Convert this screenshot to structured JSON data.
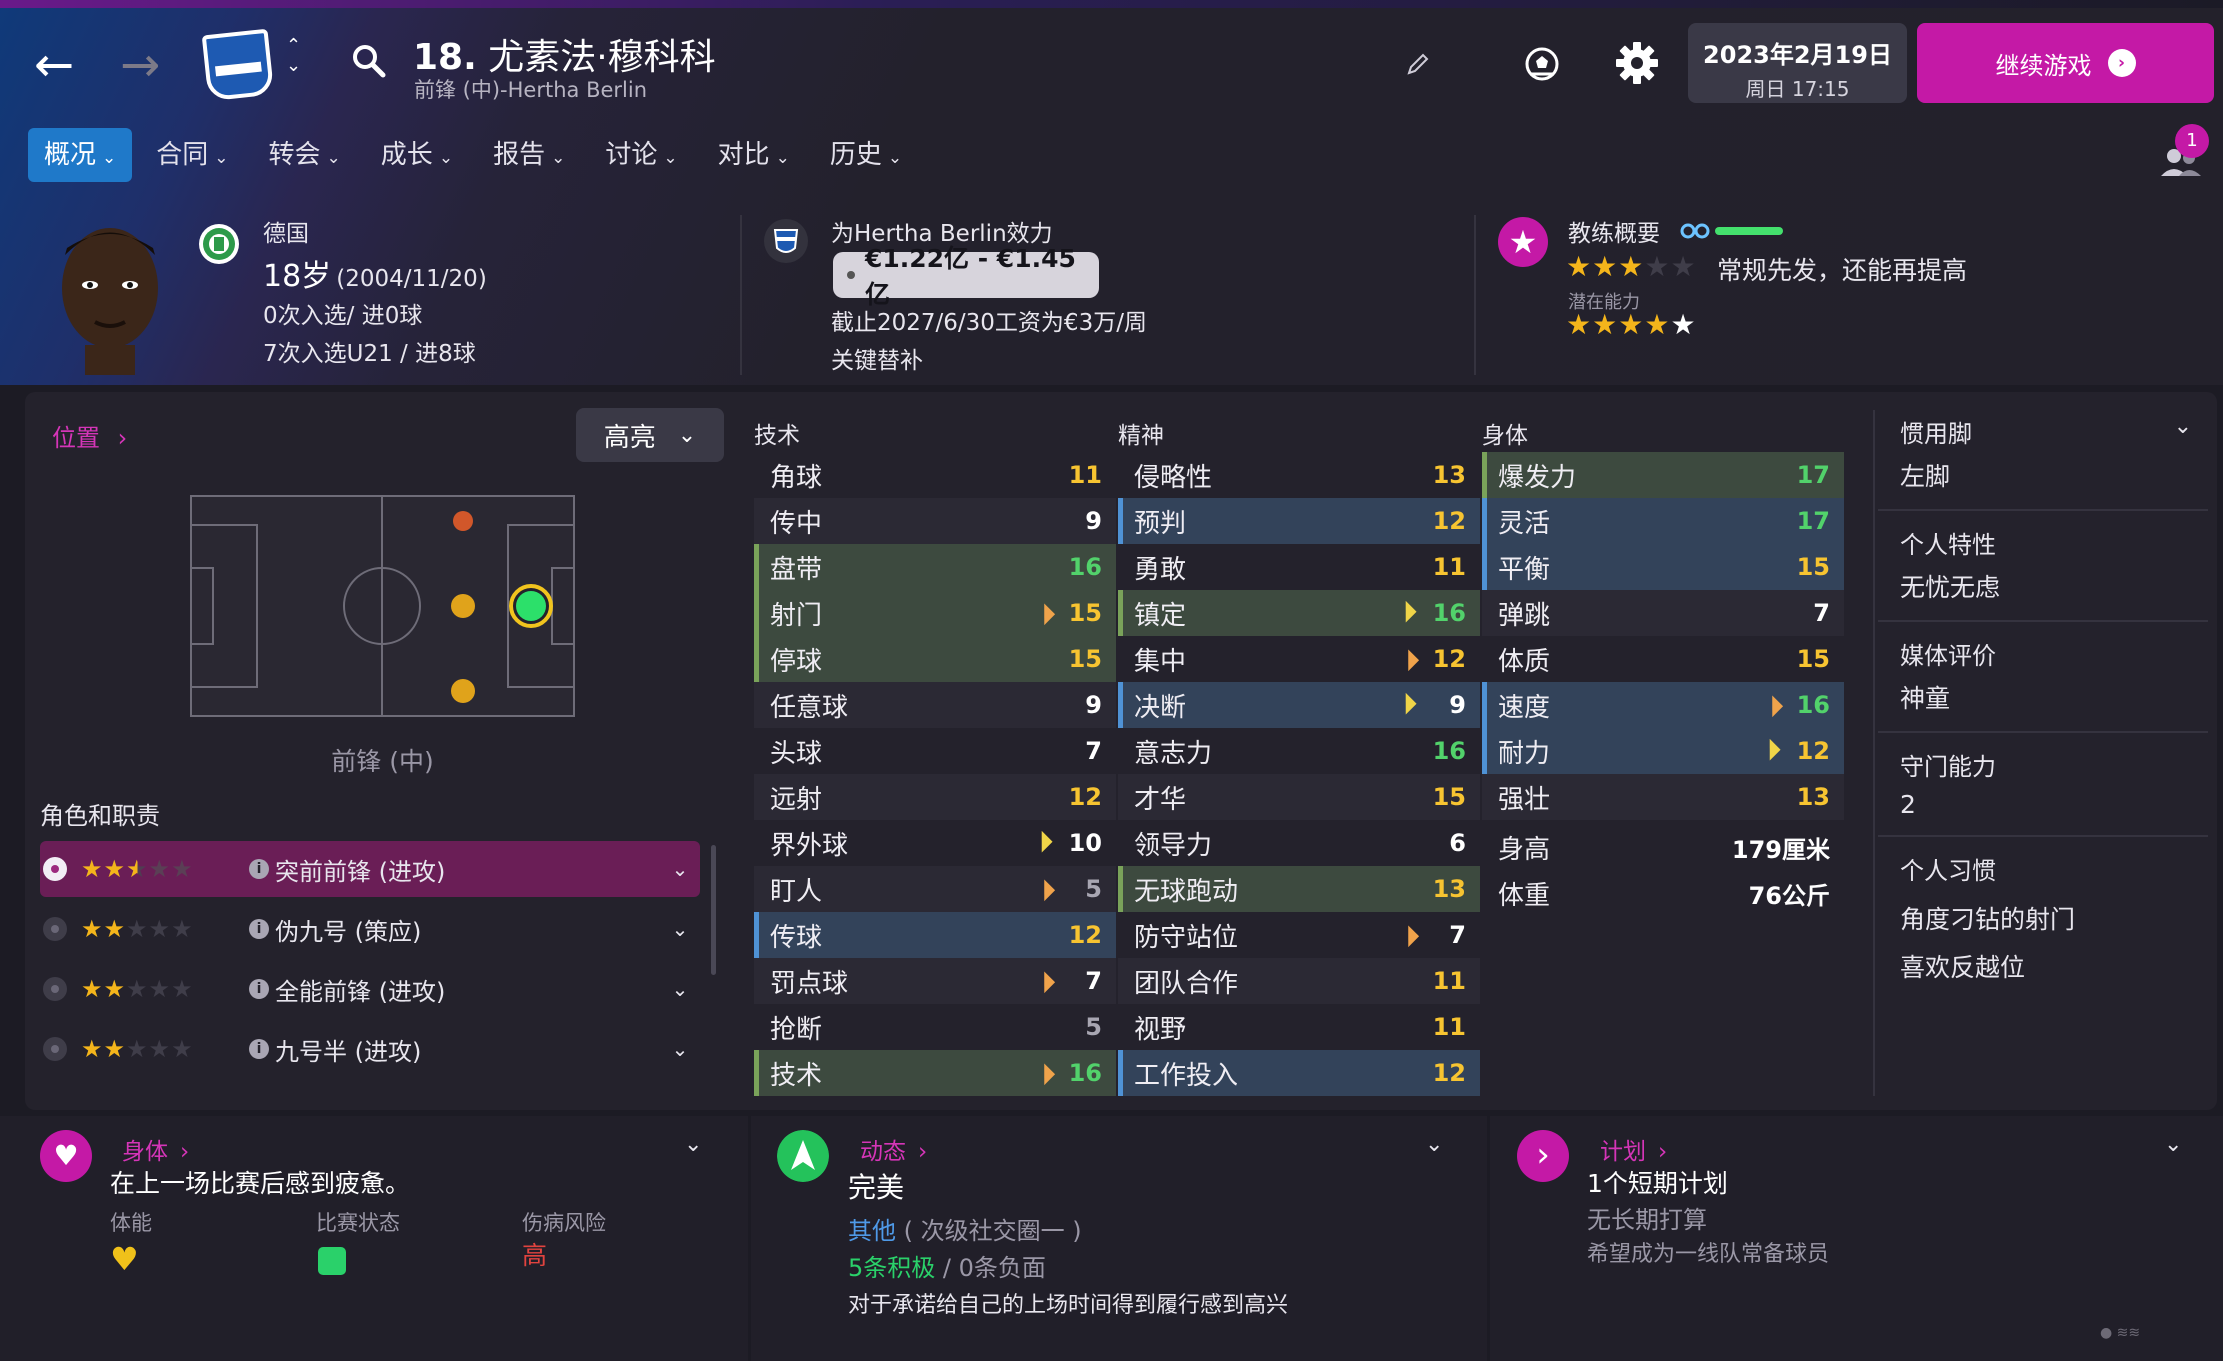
{
  "header": {
    "number": "18.",
    "name": "尤素法·穆科科",
    "subtitle": "前锋 (中)-Hertha Berlin",
    "date": "2023年2月19日",
    "weekday_time": "周日 17:15",
    "continue_label": "继续游戏",
    "notification_count": "1"
  },
  "tabs": [
    {
      "label": "概况"
    },
    {
      "label": "合同"
    },
    {
      "label": "转会"
    },
    {
      "label": "成长"
    },
    {
      "label": "报告"
    },
    {
      "label": "讨论"
    },
    {
      "label": "对比"
    },
    {
      "label": "历史"
    }
  ],
  "profile": {
    "nation": "德国",
    "age_prefix": "18岁",
    "birth": "(2004/11/20)",
    "caps": "0次入选/ 进0球",
    "u21_caps": "7次入选U21 / 进8球",
    "club_line": "为Hertha Berlin效力",
    "value": "€1.22亿 - €1.45亿",
    "contract": "截止2027/6/30工资为€3万/周",
    "squad_status": "关键替补",
    "coach_title": "教练概要",
    "coach_desc": "常规先发，还能再提高",
    "potential_label": "潜在能力",
    "current_stars": 3,
    "potential_stars": 5
  },
  "position": {
    "link": "位置",
    "highlight": "高亮",
    "label": "前锋 (中)"
  },
  "roles": {
    "title": "角色和职责",
    "items": [
      {
        "name": "突前前锋 (进攻)",
        "stars": 2.5,
        "active": true
      },
      {
        "name": "伪九号 (策应)",
        "stars": 2,
        "active": false
      },
      {
        "name": "全能前锋 (进攻)",
        "stars": 2,
        "active": false
      },
      {
        "name": "九号半 (进攻)",
        "stars": 2,
        "active": false
      }
    ]
  },
  "attributes": {
    "technical_title": "技术",
    "mental_title": "精神",
    "physical_title": "身体",
    "technical": [
      {
        "name": "角球",
        "value": "11",
        "color": "yellow"
      },
      {
        "name": "传中",
        "value": "9",
        "color": "white"
      },
      {
        "name": "盘带",
        "value": "16",
        "color": "green",
        "hl": "g"
      },
      {
        "name": "射门",
        "value": "15",
        "color": "yellow",
        "hl": "g",
        "arrow": "up"
      },
      {
        "name": "停球",
        "value": "15",
        "color": "yellow",
        "hl": "g"
      },
      {
        "name": "任意球",
        "value": "9",
        "color": "white"
      },
      {
        "name": "头球",
        "value": "7",
        "color": "white"
      },
      {
        "name": "远射",
        "value": "12",
        "color": "yellow"
      },
      {
        "name": "界外球",
        "value": "10",
        "color": "white",
        "arrow": "dn"
      },
      {
        "name": "盯人",
        "value": "5",
        "color": "grey",
        "arrow": "up"
      },
      {
        "name": "传球",
        "value": "12",
        "color": "yellow",
        "hl": "b"
      },
      {
        "name": "罚点球",
        "value": "7",
        "color": "white",
        "arrow": "up"
      },
      {
        "name": "抢断",
        "value": "5",
        "color": "grey"
      },
      {
        "name": "技术",
        "value": "16",
        "color": "green",
        "hl": "g",
        "arrow": "up"
      }
    ],
    "mental": [
      {
        "name": "侵略性",
        "value": "13",
        "color": "yellow"
      },
      {
        "name": "预判",
        "value": "12",
        "color": "yellow",
        "hl": "b"
      },
      {
        "name": "勇敢",
        "value": "11",
        "color": "yellow"
      },
      {
        "name": "镇定",
        "value": "16",
        "color": "green",
        "hl": "g",
        "arrow": "dn"
      },
      {
        "name": "集中",
        "value": "12",
        "color": "yellow",
        "arrow": "up"
      },
      {
        "name": "决断",
        "value": "9",
        "color": "white",
        "hl": "b",
        "arrow": "dn"
      },
      {
        "name": "意志力",
        "value": "16",
        "color": "green"
      },
      {
        "name": "才华",
        "value": "15",
        "color": "yellow"
      },
      {
        "name": "领导力",
        "value": "6",
        "color": "white"
      },
      {
        "name": "无球跑动",
        "value": "13",
        "color": "yellow",
        "hl": "g"
      },
      {
        "name": "防守站位",
        "value": "7",
        "color": "white",
        "arrow": "up"
      },
      {
        "name": "团队合作",
        "value": "11",
        "color": "yellow"
      },
      {
        "name": "视野",
        "value": "11",
        "color": "yellow"
      },
      {
        "name": "工作投入",
        "value": "12",
        "color": "yellow",
        "hl": "b"
      }
    ],
    "physical": [
      {
        "name": "爆发力",
        "value": "17",
        "color": "green",
        "hl": "g"
      },
      {
        "name": "灵活",
        "value": "17",
        "color": "green",
        "hl": "b"
      },
      {
        "name": "平衡",
        "value": "15",
        "color": "yellow",
        "hl": "b"
      },
      {
        "name": "弹跳",
        "value": "7",
        "color": "white"
      },
      {
        "name": "体质",
        "value": "15",
        "color": "yellow"
      },
      {
        "name": "速度",
        "value": "16",
        "color": "green",
        "hl": "b",
        "arrow": "up"
      },
      {
        "name": "耐力",
        "value": "12",
        "color": "yellow",
        "hl": "b",
        "arrow": "dn"
      },
      {
        "name": "强壮",
        "value": "13",
        "color": "yellow"
      },
      {
        "name": "身高",
        "value": "179厘米",
        "color": "white",
        "wide": true
      },
      {
        "name": "体重",
        "value": "76公斤",
        "color": "white",
        "wide": true
      }
    ]
  },
  "side": {
    "foot_label": "惯用脚",
    "foot_value": "左脚",
    "trait_label": "个人特性",
    "trait_value": "无忧无虑",
    "media_label": "媒体评价",
    "media_value": "神童",
    "gk_label": "守门能力",
    "gk_value": "2",
    "habits_label": "个人习惯",
    "habit_1": "角度刁钻的射门",
    "habit_2": "喜欢反越位"
  },
  "bottom": {
    "physical_link": "身体",
    "physical_text": "在上一场比赛后感到疲惫。",
    "fitness_label": "体能",
    "form_label": "比赛状态",
    "injury_label": "伤病风险",
    "injury_value": "高",
    "dynamics_link": "动态",
    "dynamics_value": "完美",
    "dynamics_group": "其他",
    "dynamics_group_sub": "( 次级社交圈一 )",
    "positive": "5条积极",
    "negative": "/ 0条负面",
    "dynamics_note": "对于承诺给自己的上场时间得到履行感到高兴",
    "plan_link": "计划",
    "plan_short": "1个短期计划",
    "plan_long": "无长期打算",
    "plan_wish": "希望成为一线队常备球员"
  },
  "colors": {
    "accent": "#c419a6",
    "tab_active": "#1f79c9",
    "attr_green": "#52d26b",
    "attr_yellow": "#f7c431"
  }
}
